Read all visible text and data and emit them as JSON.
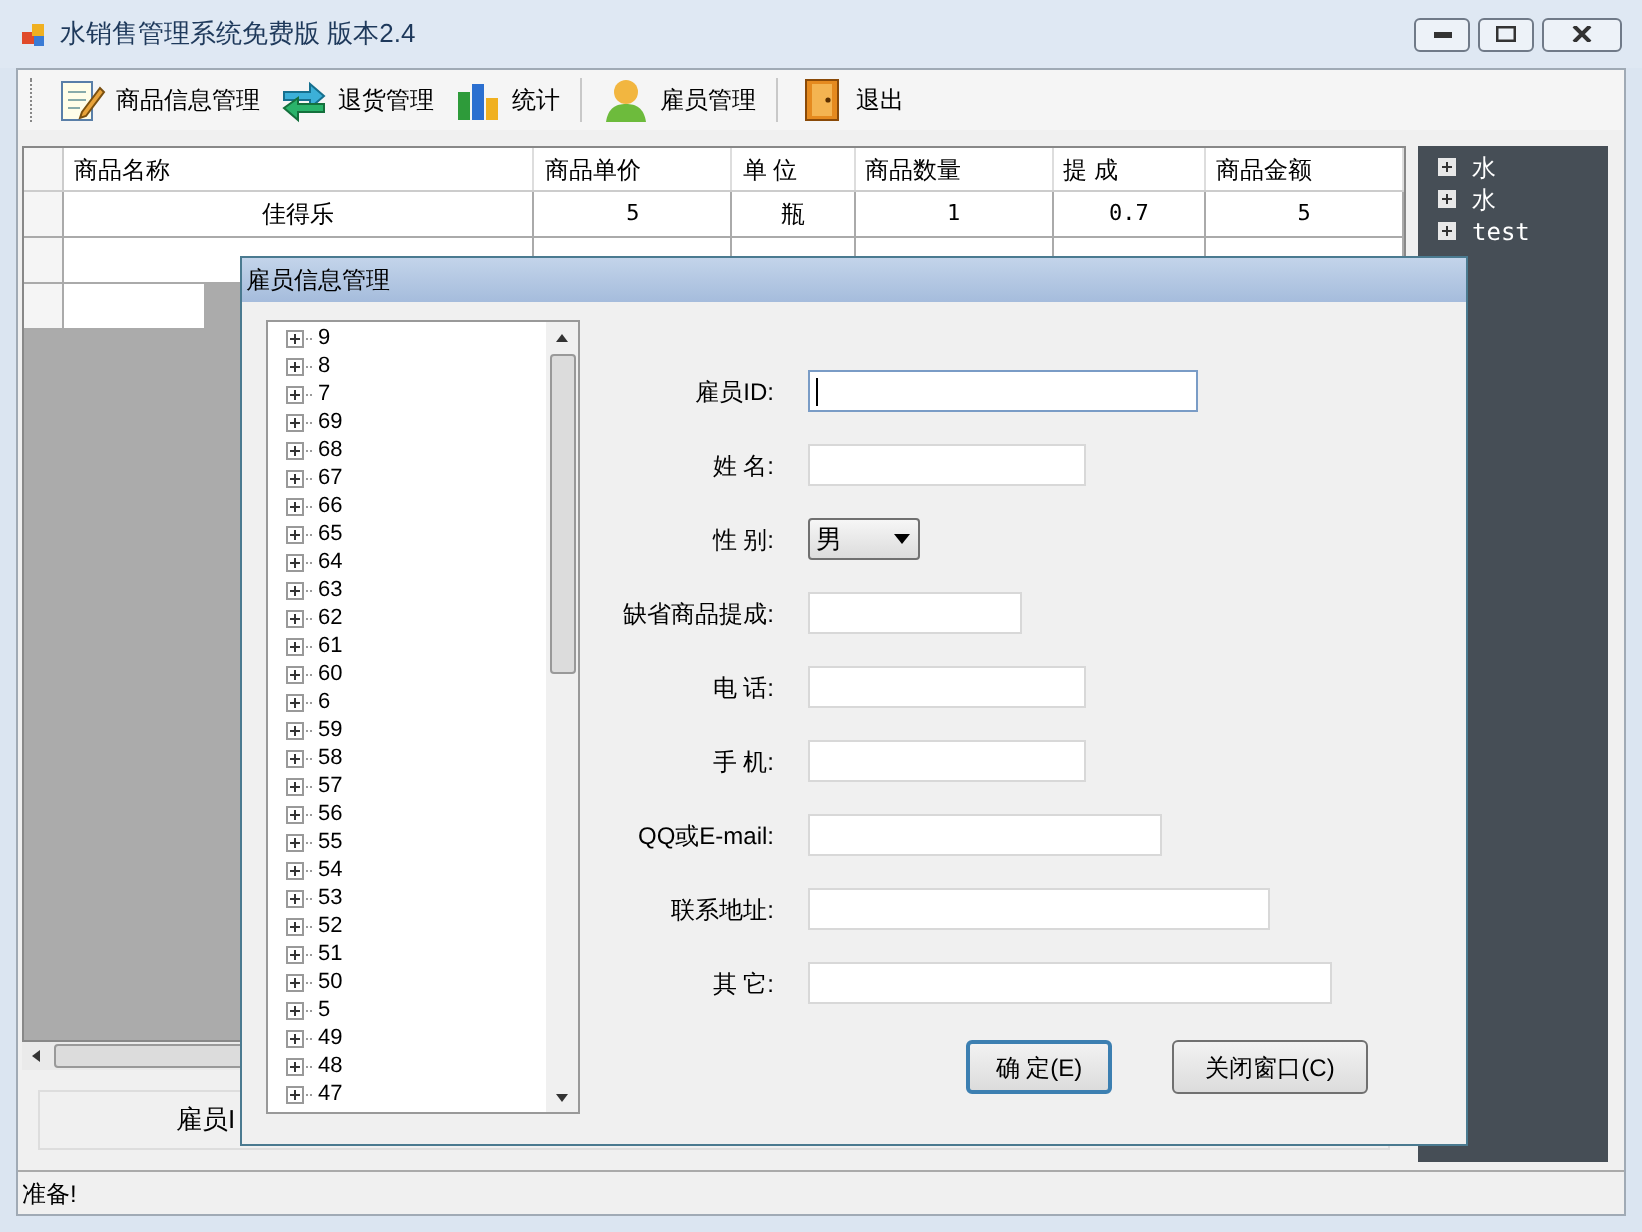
{
  "window": {
    "title": "水销售管理系统免费版 版本2.4"
  },
  "toolbar": [
    {
      "label": "商品信息管理",
      "kind": "notepad"
    },
    {
      "label": "退货管理",
      "kind": "arrows"
    },
    {
      "label": "统计",
      "kind": "chart"
    },
    {
      "label": "雇员管理",
      "kind": "person"
    },
    {
      "label": "退出",
      "kind": "door"
    }
  ],
  "table": {
    "columns": [
      "商品名称",
      "商品单价",
      "单 位",
      "商品数量",
      "提 成",
      "商品金额"
    ],
    "rows": [
      [
        "佳得乐",
        "5",
        "瓶",
        "1",
        "0.7",
        "5"
      ]
    ]
  },
  "bottom_panel": {
    "label": "雇员I"
  },
  "side_tree": {
    "items": [
      "水",
      "水",
      "test"
    ]
  },
  "status_bar": "准备!",
  "dialog": {
    "title": "雇员信息管理",
    "tree": [
      "9",
      "8",
      "7",
      "69",
      "68",
      "67",
      "66",
      "65",
      "64",
      "63",
      "62",
      "61",
      "60",
      "6",
      "59",
      "58",
      "57",
      "56",
      "55",
      "54",
      "53",
      "52",
      "51",
      "50",
      "5",
      "49",
      "48",
      "47"
    ],
    "fields": [
      {
        "label": "雇员ID:",
        "kind": "text",
        "focused": true
      },
      {
        "label": "姓 名:",
        "kind": "text",
        "focused": false
      },
      {
        "label": "性 别:",
        "kind": "select",
        "value": "男"
      },
      {
        "label": "缺省商品提成:",
        "kind": "text",
        "focused": false
      },
      {
        "label": "电 话:",
        "kind": "text",
        "focused": false
      },
      {
        "label": "手 机:",
        "kind": "text",
        "focused": false
      },
      {
        "label": "QQ或E-mail:",
        "kind": "text",
        "focused": false
      },
      {
        "label": "联系地址:",
        "kind": "text",
        "focused": false
      },
      {
        "label": "其 它:",
        "kind": "text",
        "focused": false
      }
    ],
    "buttons": [
      {
        "label": "确 定(E)",
        "default": true
      },
      {
        "label": "关闭窗口(C)",
        "default": false
      }
    ]
  }
}
